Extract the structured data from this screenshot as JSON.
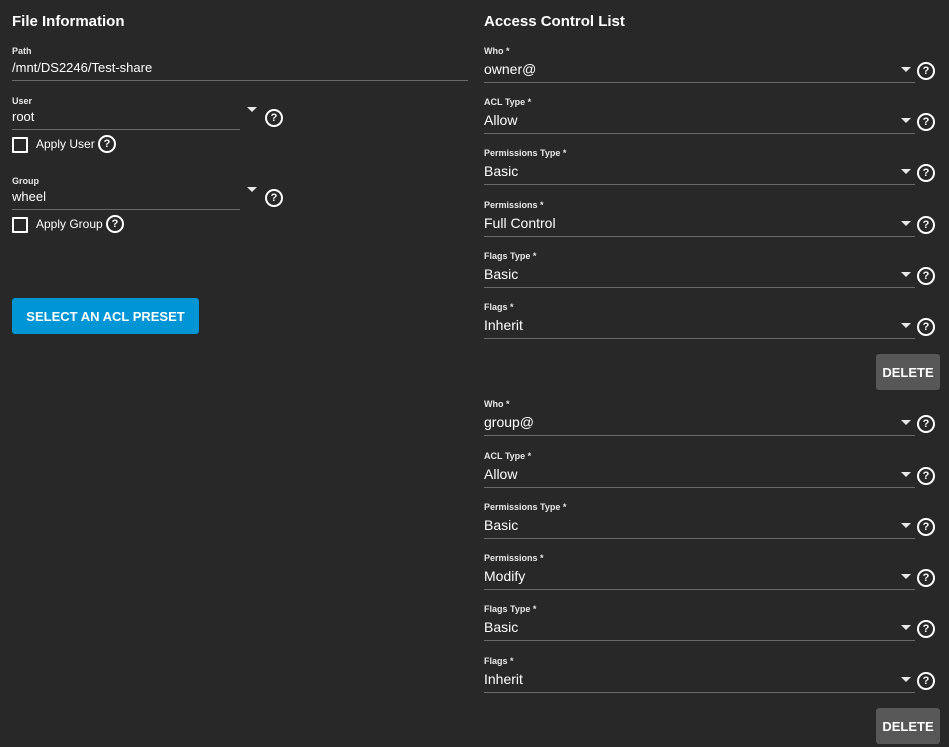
{
  "file_info": {
    "title": "File Information",
    "path": {
      "label": "Path",
      "value": "/mnt/DS2246/Test-share"
    },
    "user": {
      "label": "User",
      "value": "root",
      "apply_label": "Apply User"
    },
    "group": {
      "label": "Group",
      "value": "wheel",
      "apply_label": "Apply Group"
    },
    "preset_button": "SELECT AN ACL PRESET",
    "help_glyph": "?"
  },
  "acl": {
    "title": "Access Control List",
    "delete_label": "DELETE",
    "entries": [
      {
        "who": {
          "label": "Who *",
          "value": "owner@"
        },
        "acl_type": {
          "label": "ACL Type *",
          "value": "Allow"
        },
        "perm_type": {
          "label": "Permissions Type *",
          "value": "Basic"
        },
        "perms": {
          "label": "Permissions *",
          "value": "Full Control"
        },
        "flags_type": {
          "label": "Flags Type *",
          "value": "Basic"
        },
        "flags": {
          "label": "Flags *",
          "value": "Inherit"
        }
      },
      {
        "who": {
          "label": "Who *",
          "value": "group@"
        },
        "acl_type": {
          "label": "ACL Type *",
          "value": "Allow"
        },
        "perm_type": {
          "label": "Permissions Type *",
          "value": "Basic"
        },
        "perms": {
          "label": "Permissions *",
          "value": "Modify"
        },
        "flags_type": {
          "label": "Flags Type *",
          "value": "Basic"
        },
        "flags": {
          "label": "Flags *",
          "value": "Inherit"
        }
      }
    ]
  }
}
